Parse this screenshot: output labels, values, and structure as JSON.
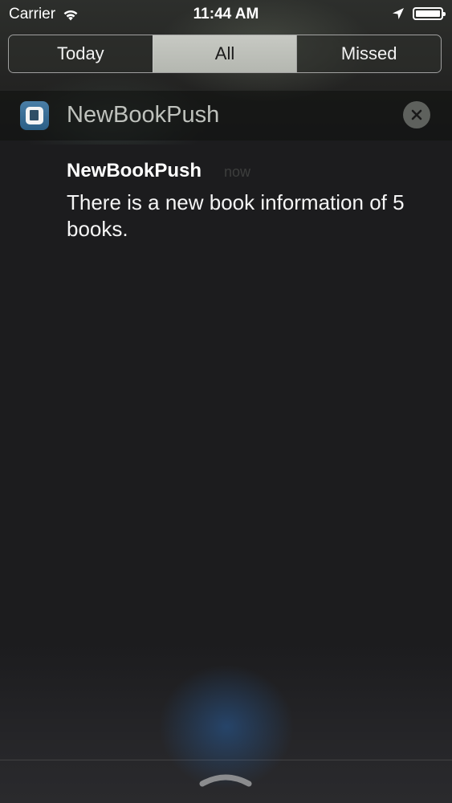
{
  "status_bar": {
    "carrier": "Carrier",
    "time": "11:44 AM",
    "wifi_icon": "wifi-icon",
    "location_icon": "location-arrow-icon",
    "battery_icon": "battery-icon",
    "battery_level": 1.0
  },
  "segments": {
    "today": "Today",
    "all": "All",
    "missed": "Missed",
    "selected": "All"
  },
  "app_group": {
    "app_name": "NewBookPush",
    "app_icon": "book-app-icon",
    "clear_icon": "close-icon"
  },
  "notification": {
    "title": "NewBookPush",
    "time": "now",
    "body": "There is a new book information of 5 books."
  },
  "bottom": {
    "grabber_icon": "grabber-handle-icon"
  },
  "colors": {
    "selected_segment": "#bfc1bb",
    "background": "#1c1c1e",
    "accent_glow": "#285fa0"
  }
}
